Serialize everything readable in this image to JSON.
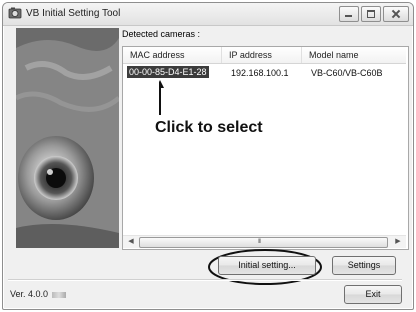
{
  "window": {
    "title": "VB Initial Setting Tool"
  },
  "list": {
    "label": "Detected cameras :",
    "columns": [
      "MAC address",
      "IP address",
      "Model name"
    ],
    "rows": [
      {
        "mac": "00-00-85-D4-E1-28",
        "ip": "192.168.100.1",
        "model": "VB-C60/VB-C60B"
      }
    ],
    "scroll_grip": "III"
  },
  "annotation": {
    "text": "Click to select"
  },
  "buttons": {
    "initial_setting": "Initial setting...",
    "settings": "Settings",
    "exit": "Exit"
  },
  "footer": {
    "version": "Ver. 4.0.0"
  },
  "colors": {
    "selection": "#3c3c3c",
    "banner": "#7c7c7c"
  }
}
